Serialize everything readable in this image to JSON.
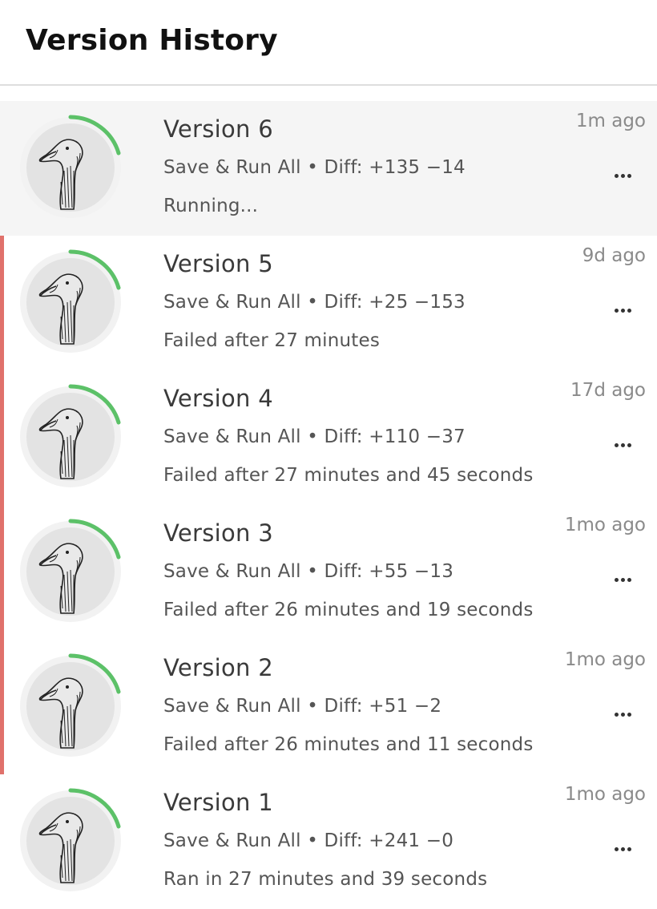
{
  "header": {
    "title": "Version History"
  },
  "colors": {
    "progress_ring": "#5cc168",
    "failed_indicator": "#e0716b",
    "active_row_bg": "#f5f5f5"
  },
  "versions": [
    {
      "title": "Version 6",
      "meta": "Save & Run All • Diff: +135 −14",
      "status": "Running...",
      "time": "1m ago",
      "state": "running",
      "active": true
    },
    {
      "title": "Version 5",
      "meta": "Save & Run All • Diff: +25 −153",
      "status": "Failed after 27 minutes",
      "time": "9d ago",
      "state": "failed",
      "active": false
    },
    {
      "title": "Version 4",
      "meta": "Save & Run All • Diff: +110 −37",
      "status": "Failed after 27 minutes and 45 seconds",
      "time": "17d ago",
      "state": "failed",
      "active": false
    },
    {
      "title": "Version 3",
      "meta": "Save & Run All • Diff: +55 −13",
      "status": "Failed after 26 minutes and 19 seconds",
      "time": "1mo ago",
      "state": "failed",
      "active": false
    },
    {
      "title": "Version 2",
      "meta": "Save & Run All • Diff: +51 −2",
      "status": "Failed after 26 minutes and 11 seconds",
      "time": "1mo ago",
      "state": "failed",
      "active": false
    },
    {
      "title": "Version 1",
      "meta": "Save & Run All • Diff: +241 −0",
      "status": "Ran in 27 minutes and 39 seconds",
      "time": "1mo ago",
      "state": "complete",
      "active": false
    }
  ],
  "icons": {
    "avatar": "goose-avatar-icon",
    "more": "more-options-icon",
    "progress": "progress-ring-icon"
  }
}
